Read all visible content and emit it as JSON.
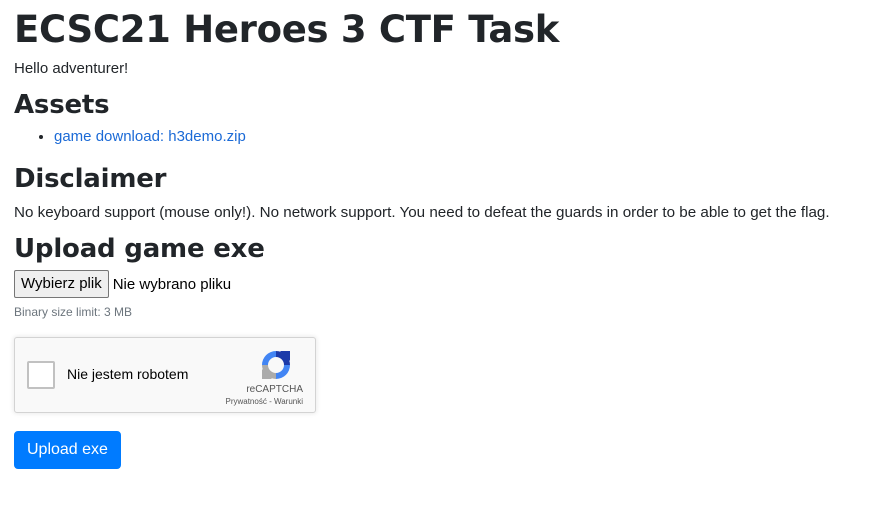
{
  "page": {
    "title": "ECSC21 Heroes 3 CTF Task",
    "greeting": "Hello adventurer!"
  },
  "assets": {
    "heading": "Assets",
    "items": [
      {
        "label": "game download: h3demo.zip"
      }
    ]
  },
  "disclaimer": {
    "heading": "Disclaimer",
    "text": "No keyboard support (mouse only!). No network support. You need to defeat the guards in order to be able to get the flag."
  },
  "upload": {
    "heading": "Upload game exe",
    "file_button_label": "Wybierz plik",
    "file_status": "Nie wybrano pliku",
    "size_hint": "Binary size limit: 3 MB",
    "submit_label": "Upload exe"
  },
  "recaptcha": {
    "checkbox_label": "Nie jestem robotem",
    "brand": "reCAPTCHA",
    "privacy_link": "Prywatność",
    "separator": " - ",
    "terms_link": "Warunki",
    "logo_icon": "recaptcha-logo-icon"
  },
  "colors": {
    "link": "#1b6ad6",
    "primary_button": "#007bff",
    "muted_text": "#6c757d"
  }
}
